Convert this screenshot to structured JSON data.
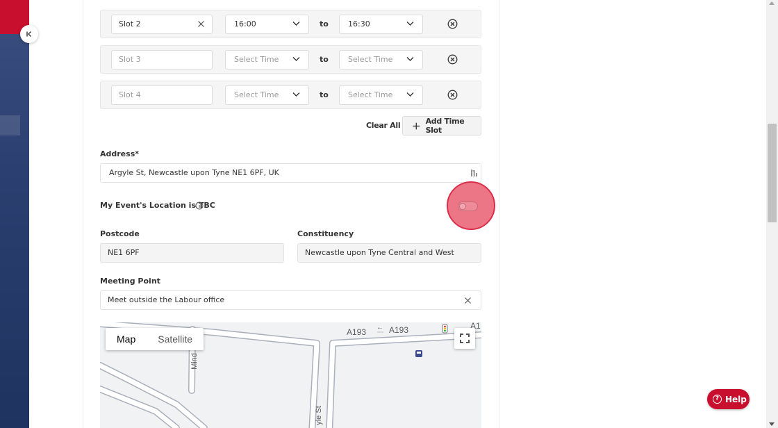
{
  "sidebar": {
    "collapse_icon": "collapse-left-icon"
  },
  "slots": [
    {
      "name": "Slot 2",
      "name_is_placeholder": false,
      "start": "16:00",
      "start_is_placeholder": false,
      "end": "16:30",
      "end_is_placeholder": false
    },
    {
      "name": "Slot 3",
      "name_is_placeholder": true,
      "start": "Select Time",
      "start_is_placeholder": true,
      "end": "Select Time",
      "end_is_placeholder": true
    },
    {
      "name": "Slot 4",
      "name_is_placeholder": true,
      "start": "Select Time",
      "start_is_placeholder": true,
      "end": "Select Time",
      "end_is_placeholder": true
    }
  ],
  "to_label": "to",
  "actions": {
    "clear_all": "Clear All",
    "add_time_slot": "Add Time Slot"
  },
  "address": {
    "label": "Address*",
    "value": "Argyle St, Newcastle upon Tyne NE1 6PF, UK"
  },
  "tbc": {
    "label": "My Event's Location is TBC",
    "enabled": false
  },
  "postcode": {
    "label": "Postcode",
    "value": "NE1 6PF"
  },
  "constituency": {
    "label": "Constituency",
    "value": "Newcastle upon Tyne Central and West"
  },
  "meeting_point": {
    "label": "Meeting Point",
    "value": "Meet outside the Labour office"
  },
  "map": {
    "type_options": [
      "Map",
      "Satellite"
    ],
    "selected_type": "Map",
    "road_labels": {
      "a193_left": "A193",
      "a193_right": "A193",
      "edge": "A1",
      "mind": "Mind",
      "argyle": "yle St"
    }
  },
  "help": {
    "label": "Help"
  },
  "colors": {
    "brand": "#c8102e",
    "sidebar": "#2b3f70",
    "highlight": "#e85064"
  }
}
